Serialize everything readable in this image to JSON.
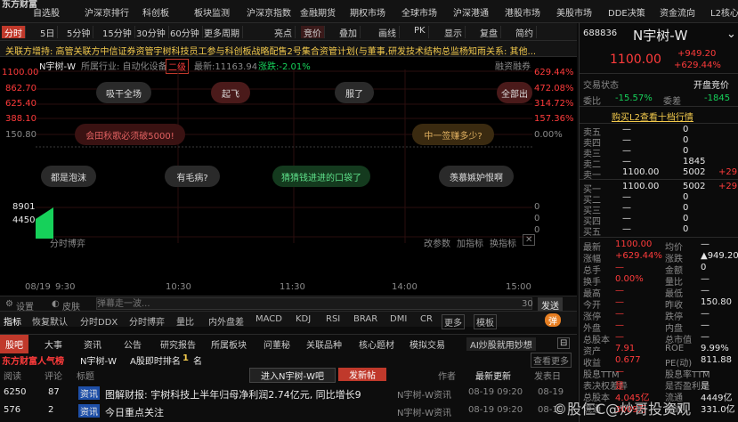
{
  "menubar": {
    "logo": "东方财富",
    "items": [
      "自选股",
      "沪深京排行",
      "科创板",
      "板块监测",
      "沪深京指数",
      "金融期货",
      "期权市场",
      "全球市场",
      "沪深港通",
      "港股市场",
      "美股市场",
      "DDE决策",
      "资金流向",
      "L2核心"
    ]
  },
  "toolbar": {
    "items": [
      "分时",
      "5日",
      "5分钟",
      "15分钟",
      "30分钟",
      "60分钟",
      "更多周期",
      "亮点",
      "竞价",
      "叠加",
      "画线",
      "PK",
      "显示",
      "复盘",
      "简约"
    ]
  },
  "news": {
    "text": "关联方增持: 高管关联方中信证券资管宇树科技员工参与科创板战略配售2号集合资管计划(与董事,研发技术结构总监杨知雨关系: 其他..."
  },
  "chart": {
    "stock": "N宇树-W",
    "industry_label": "所属行业: 自动化设备",
    "level": "二级",
    "latest_label": "最新:11163.94",
    "change_label": "涨跌:-2.01%",
    "margin": "融资融券",
    "yticks_left": [
      "1100.00",
      "862.70",
      "625.40",
      "388.10",
      "150.80"
    ],
    "yticks_right": [
      "629.44%",
      "472.08%",
      "314.72%",
      "157.36%",
      "0.00%"
    ],
    "vol_left": [
      "8901",
      "4450"
    ],
    "vol_right": [
      "0",
      "0",
      "0"
    ],
    "xticks": [
      "08/19",
      "9:30",
      "10:30",
      "11:30",
      "14:00",
      "15:00"
    ],
    "bubbles": [
      "吸干全场",
      "起飞",
      "服了",
      "全部出",
      "会田秋歌必须破5000!",
      "中一签赚多少?",
      "都是泡沫",
      "有毛病?",
      "猜猜钱进进的口袋了",
      "羡慕嫉妒恨啊"
    ],
    "footer": [
      "分时博弈",
      "改参数",
      "加指标",
      "换指标"
    ],
    "danmu": {
      "settings": "设置",
      "skin": "皮肤",
      "placeholder": "弹幕走一波...",
      "count": "30",
      "send": "发送"
    }
  },
  "bottomtabs": {
    "items": [
      "指标",
      "恢复默认",
      "分时DDX",
      "分时博弈",
      "量比",
      "内外盘差",
      "MACD",
      "KDJ",
      "RSI",
      "BRAR",
      "DMI",
      "CR",
      "更多",
      "模板"
    ],
    "toggle": "弹"
  },
  "guba": {
    "tabs": [
      "股吧",
      "大事",
      "资讯",
      "公告",
      "研究报告",
      "所属板块",
      "问董秘",
      "关联品种",
      "核心题材",
      "模拟交易",
      "AI炒股就用妙想"
    ],
    "brand": "东方财富人气榜",
    "stock": "N宇树-W",
    "rank_label": "A股即时排名",
    "rank": "1",
    "rank_unit": "名",
    "view_more": "查看更多",
    "enter_bar": "进入N宇树-W吧",
    "post": "发新帖",
    "headers": {
      "read": "阅读",
      "comment": "评论",
      "title": "标题",
      "author": "作者",
      "updated": "最新更新",
      "posted": "发表日"
    },
    "rows": [
      {
        "read": "6250",
        "comment": "87",
        "tag": "资讯",
        "title": "图解财报: 宇树科技上半年归母净利润2.74亿元, 同比增长9",
        "author": "N宇树-W资讯",
        "updated": "08-19 09:20",
        "posted": "08-19"
      },
      {
        "read": "576",
        "comment": "2",
        "tag": "资讯",
        "title": "今日重点关注",
        "author": "N宇树-W资讯",
        "updated": "08-19 09:20",
        "posted": "08-19"
      }
    ]
  },
  "quote": {
    "code": "688836",
    "name": "N宇树-W",
    "price": "1100.00",
    "change": "+949.20",
    "pct": "+629.44%",
    "status_label": "交易状态",
    "status": "开盘竞价",
    "weibi_label": "委比",
    "weibi": "-15.57%",
    "weicha_label": "委差",
    "weicha": "-1845",
    "l2": "购买L2查看十档行情",
    "asks": [
      {
        "l": "卖五",
        "p": "—",
        "v": "0",
        "d": ""
      },
      {
        "l": "卖四",
        "p": "—",
        "v": "0",
        "d": ""
      },
      {
        "l": "卖三",
        "p": "—",
        "v": "0",
        "d": ""
      },
      {
        "l": "卖二",
        "p": "—",
        "v": "1845",
        "d": ""
      },
      {
        "l": "卖一",
        "p": "1100.00",
        "v": "5002",
        "d": "+29"
      }
    ],
    "bids": [
      {
        "l": "买一",
        "p": "1100.00",
        "v": "5002",
        "d": "+29"
      },
      {
        "l": "买二",
        "p": "—",
        "v": "0",
        "d": ""
      },
      {
        "l": "买三",
        "p": "—",
        "v": "0",
        "d": ""
      },
      {
        "l": "买四",
        "p": "—",
        "v": "0",
        "d": ""
      },
      {
        "l": "买五",
        "p": "—",
        "v": "0",
        "d": ""
      }
    ],
    "stats": [
      [
        "最新",
        "1100.00",
        "均价",
        "—"
      ],
      [
        "涨幅",
        "+629.44%",
        "涨跌",
        "▲949.20"
      ],
      [
        "总手",
        "—",
        "金额",
        "0"
      ],
      [
        "换手",
        "0.00%",
        "量比",
        "—"
      ],
      [
        "最高",
        "—",
        "最低",
        "—"
      ],
      [
        "今开",
        "—",
        "昨收",
        "150.80"
      ],
      [
        "涨停",
        "—",
        "跌停",
        "—"
      ],
      [
        "外盘",
        "—",
        "内盘",
        "—"
      ],
      [
        "总股本",
        "—",
        "总市值",
        "—"
      ],
      [
        "资产",
        "7.91",
        "ROE",
        "9.99%"
      ],
      [
        "收益",
        "0.677",
        "PE(动)",
        "811.88"
      ],
      [
        "股息TTM",
        "—",
        "股息率TTM",
        "—"
      ],
      [
        "表决权差异",
        "是",
        "是否盈利",
        "是"
      ],
      [
        "总股本",
        "4.045亿",
        "流通",
        "4449亿"
      ],
      [
        "流通",
        "3009万",
        "流通",
        "331.0亿"
      ]
    ]
  },
  "watermark": "©股仨C@炒哥投资观"
}
